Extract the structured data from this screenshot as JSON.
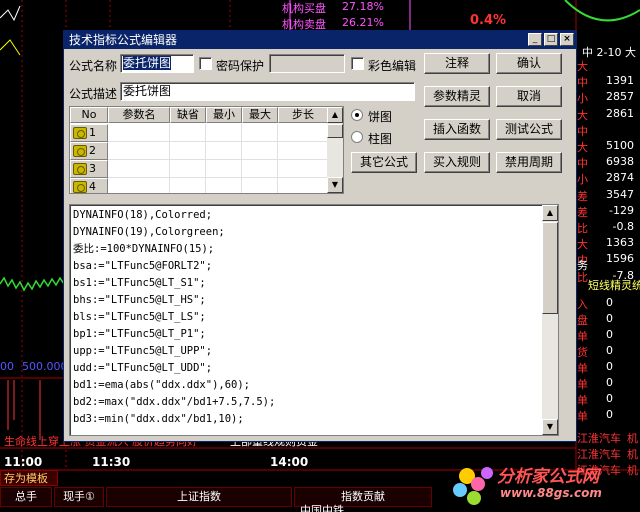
{
  "background": {
    "market_rows": [
      {
        "label": "机构买盘",
        "value": "27.18%"
      },
      {
        "label": "机构卖盘",
        "value": "26.21%"
      }
    ],
    "big_percent": "0.4%",
    "right_panel_header": "中 2-10 大",
    "right_panel_rows": [
      {
        "label": "大",
        "value": "",
        "tone": "white"
      },
      {
        "label": "中",
        "value": "1391",
        "tone": "white"
      },
      {
        "label": "小",
        "value": "2857",
        "tone": "white"
      },
      {
        "label": "大",
        "value": "2861",
        "tone": "white"
      },
      {
        "label": "中",
        "value": "",
        "tone": "white"
      },
      {
        "label": "大",
        "value": "5100",
        "tone": "white"
      },
      {
        "label": "中",
        "value": "6938",
        "tone": "white"
      },
      {
        "label": "小",
        "value": "2874",
        "tone": "white"
      },
      {
        "label": "差",
        "value": "3547",
        "tone": "white"
      },
      {
        "label": "差",
        "value": "-129",
        "tone": "white"
      },
      {
        "label": "比",
        "value": "-0.8",
        "tone": "white"
      },
      {
        "label": "大",
        "value": "1363",
        "tone": "white"
      },
      {
        "label": "中",
        "value": "1596",
        "tone": "white"
      },
      {
        "label": "比",
        "value": "-7.8",
        "tone": "white"
      }
    ],
    "right_tab": "务",
    "right_subtitle": "短线精灵统计",
    "right_list": [
      "入",
      "盘",
      "单",
      "货",
      "单",
      "单",
      "单",
      "单"
    ],
    "right_list_right": [
      "0",
      "0",
      "0",
      "0",
      "0",
      "0",
      "0",
      "0"
    ],
    "stock_names": [
      "江淮汽车",
      "江淮汽车",
      "江淮汽车"
    ],
    "stock_suffix": "机",
    "price_labels": [
      "00",
      "500.000"
    ],
    "ticker_text": "生命线上穿上涨 资金流入 股价趋势向好",
    "bottom_scroll_text": "上部量线规则资金",
    "time_labels": [
      "11:00",
      "11:30",
      "14:00"
    ],
    "save_tab": "存为模板",
    "grid_headers": [
      "总手",
      "现手①",
      "上证指数",
      "指数贡献"
    ],
    "watermark_title": "分析家公式网",
    "watermark_url": "www.88gs.com",
    "bottom_partial": "中国中铁"
  },
  "dialog": {
    "title": "技术指标公式编辑器",
    "formula_name_label": "公式名称",
    "formula_name_value": "委托饼图",
    "password_label": "密码保护",
    "color_edit_label": "彩色编辑",
    "formula_desc_label": "公式描述",
    "formula_desc_value": "委托饼图",
    "buttons": {
      "annotate": "注释",
      "ok": "确认",
      "param_wizard": "参数精灵",
      "cancel": "取消",
      "insert_func": "插入函数",
      "test_formula": "测试公式",
      "other_formula": "其它公式",
      "buy_rule": "买入规则",
      "disable_period": "禁用周期"
    },
    "radio_pie": "饼图",
    "radio_bar": "柱图",
    "param_table": {
      "headers": [
        "No",
        "参数名",
        "缺省",
        "最小",
        "最大",
        "步长"
      ],
      "rows": [
        "1",
        "2",
        "3",
        "4"
      ]
    },
    "code_lines": [
      "DYNAINFO(18),Colorred;",
      "DYNAINFO(19),Colorgreen;",
      "委比:=100*DYNAINFO(15);",
      "bsa:=\"LTFunc5@FORLT2\";",
      "bs1:=\"LTFunc5@LT_S1\";",
      "bhs:=\"LTFunc5@LT_HS\";",
      "bls:=\"LTFunc5@LT_LS\";",
      "bp1:=\"LTFunc5@LT_P1\";",
      "upp:=\"LTFunc5@LT_UPP\";",
      "udd:=\"LTFunc5@LT_UDD\";",
      "bd1:=ema(abs(\"ddx.ddx\"),60);",
      "bd2:=max(\"ddx.ddx\"/bd1+7.5,7.5);",
      "bd3:=min(\"ddx.ddx\"/bd1,10);"
    ]
  }
}
